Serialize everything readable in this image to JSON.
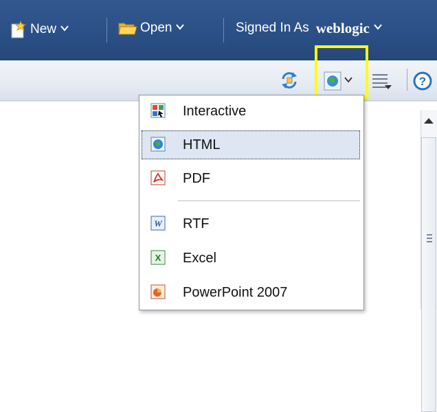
{
  "topbar": {
    "new_label": "New",
    "open_label": "Open",
    "signed_in_prefix": "Signed In As",
    "username": "weblogic"
  },
  "toolbar": {
    "icons": [
      "refresh-icon",
      "export-icon",
      "options-icon",
      "help-icon"
    ],
    "highlight_color": "#ffff00"
  },
  "export_menu": {
    "items": [
      {
        "label": "Interactive",
        "icon": "interactive-icon"
      },
      {
        "label": "HTML",
        "icon": "html-icon",
        "selected": true
      },
      {
        "label": "PDF",
        "icon": "pdf-icon"
      },
      {
        "label": "RTF",
        "icon": "rtf-icon"
      },
      {
        "label": "Excel",
        "icon": "excel-icon"
      },
      {
        "label": "PowerPoint 2007",
        "icon": "powerpoint-icon"
      }
    ]
  },
  "colors": {
    "topbar": "#2a4f86",
    "selected_item": "#dde6f2"
  }
}
